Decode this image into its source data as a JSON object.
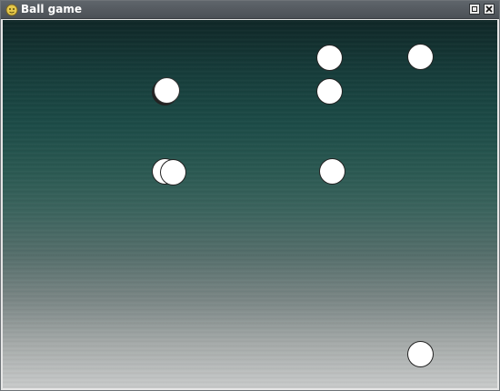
{
  "window": {
    "title": "Ball game",
    "icon": "app-icon",
    "controls": [
      "maximize-icon",
      "close-icon"
    ]
  },
  "game": {
    "background": "gradient-teal-to-gray",
    "ball_color": "#ffffff",
    "ball_count": 8
  }
}
